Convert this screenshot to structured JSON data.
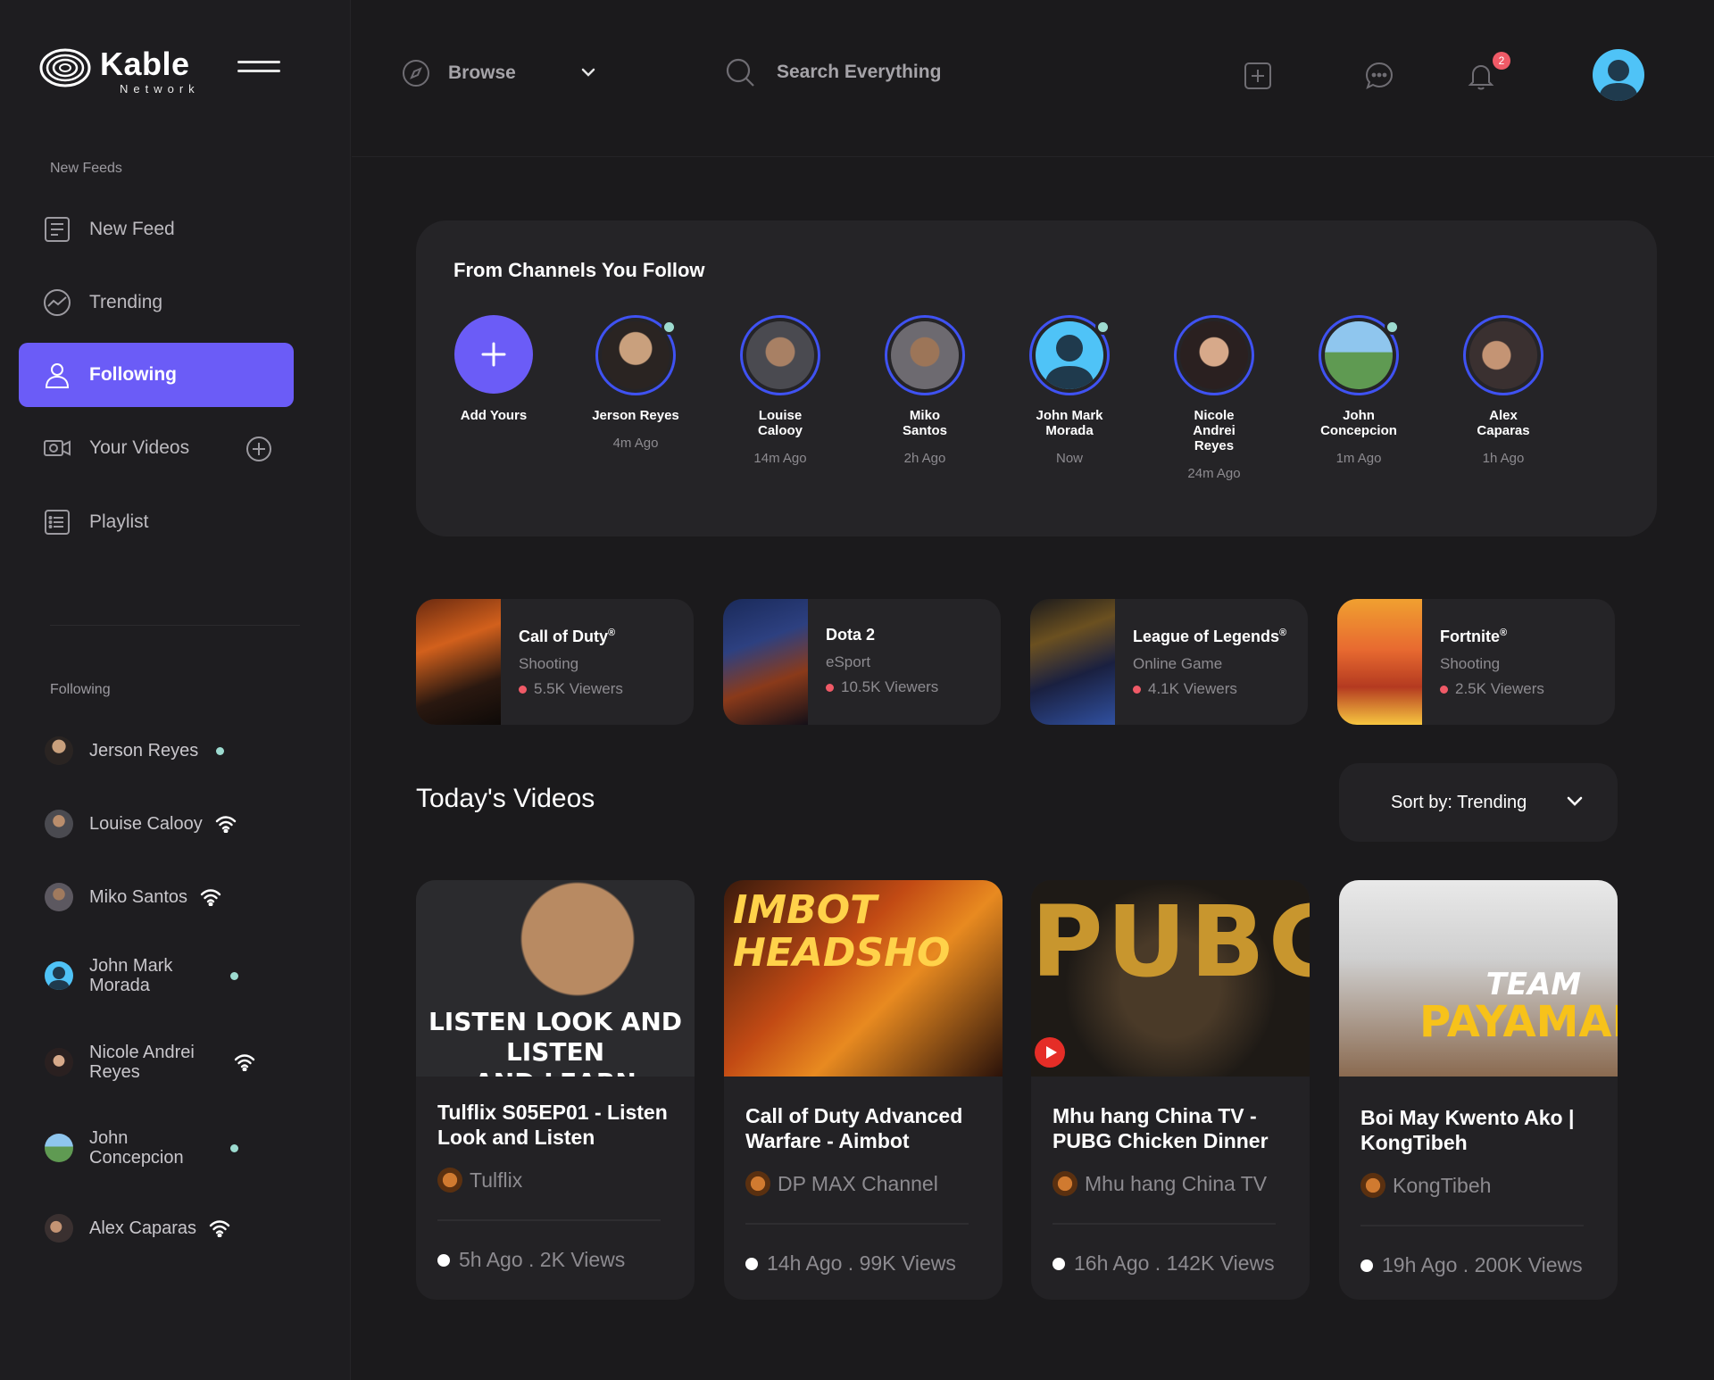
{
  "app": {
    "logo_title": "Kable",
    "logo_sub": "Network"
  },
  "sidebar": {
    "section_feeds": "New Feeds",
    "nav": [
      {
        "label": "New Feed",
        "icon": "newspaper-icon"
      },
      {
        "label": "Trending",
        "icon": "trending-icon"
      },
      {
        "label": "Following",
        "icon": "user-icon",
        "active": true
      },
      {
        "label": "Your Videos",
        "icon": "video-camera-icon"
      },
      {
        "label": "Playlist",
        "icon": "list-icon"
      }
    ],
    "section_following": "Following",
    "following": [
      {
        "name": "Jerson Reyes",
        "status": "dot"
      },
      {
        "name": "Louise Calooy",
        "status": "wifi"
      },
      {
        "name": "Miko Santos",
        "status": "wifi"
      },
      {
        "name": "John Mark Morada",
        "status": "dot"
      },
      {
        "name": "Nicole Andrei Reyes",
        "status": "wifi"
      },
      {
        "name": "John Concepcion",
        "status": "dot"
      },
      {
        "name": "Alex Caparas",
        "status": "wifi"
      }
    ]
  },
  "header": {
    "browse_label": "Browse",
    "search_placeholder": "Search Everything",
    "notification_count": "2"
  },
  "channels": {
    "title": "From Channels You Follow",
    "add_label": "Add Yours",
    "items": [
      {
        "name": "Jerson Reyes",
        "time": "4m Ago",
        "online": true
      },
      {
        "name": "Louise Calooy",
        "time": "14m Ago",
        "online": false
      },
      {
        "name": "Miko Santos",
        "time": "2h Ago",
        "online": false
      },
      {
        "name": "John Mark Morada",
        "time": "Now",
        "online": true
      },
      {
        "name": "Nicole Andrei Reyes",
        "time": "24m Ago",
        "online": false
      },
      {
        "name": "John Concepcion",
        "time": "1m Ago",
        "online": true
      },
      {
        "name": "Alex Caparas",
        "time": "1h Ago",
        "online": false
      }
    ]
  },
  "games": [
    {
      "name": "Call of Duty",
      "reg": "®",
      "category": "Shooting",
      "viewers": "5.5K Viewers"
    },
    {
      "name": "Dota 2",
      "reg": "",
      "category": "eSport",
      "viewers": "10.5K Viewers"
    },
    {
      "name": "League of Legends",
      "reg": "®",
      "category": "Online Game",
      "viewers": "4.1K Viewers"
    },
    {
      "name": "Fortnite",
      "reg": "®",
      "category": "Shooting",
      "viewers": "2.5K Viewers"
    }
  ],
  "videos_section": {
    "title": "Today's Videos",
    "sort_label": "Sort by: Trending"
  },
  "videos": [
    {
      "title": "Tulflix S05EP01 - Listen Look and Listen",
      "channel": "Tulflix",
      "meta": "5h Ago . 2K Views",
      "thumb_text_1": "LISTEN LOOK AND LISTEN",
      "thumb_text_2": "AND LEARN"
    },
    {
      "title": "Call of Duty Advanced Warfare - Aimbot",
      "channel": "DP MAX Channel",
      "meta": "14h Ago . 99K Views",
      "thumb_text_1": "IMBOT",
      "thumb_text_2": "HEADSHO"
    },
    {
      "title": "Mhu hang China TV - PUBG Chicken Dinner",
      "channel": "Mhu hang China TV",
      "meta": "16h Ago . 142K Views",
      "thumb_text_1": "PUBG",
      "thumb_text_2": ""
    },
    {
      "title": "Boi May Kwento Ako | KongTibeh",
      "channel": "KongTibeh",
      "meta": "19h Ago . 200K Views",
      "thumb_text_1": "TEAM",
      "thumb_text_2": "PAYAMAN"
    }
  ],
  "colors": {
    "accent": "#6b5cf7",
    "ring": "#3f52f2",
    "online": "#9ddbd0",
    "live": "#f05a67"
  }
}
